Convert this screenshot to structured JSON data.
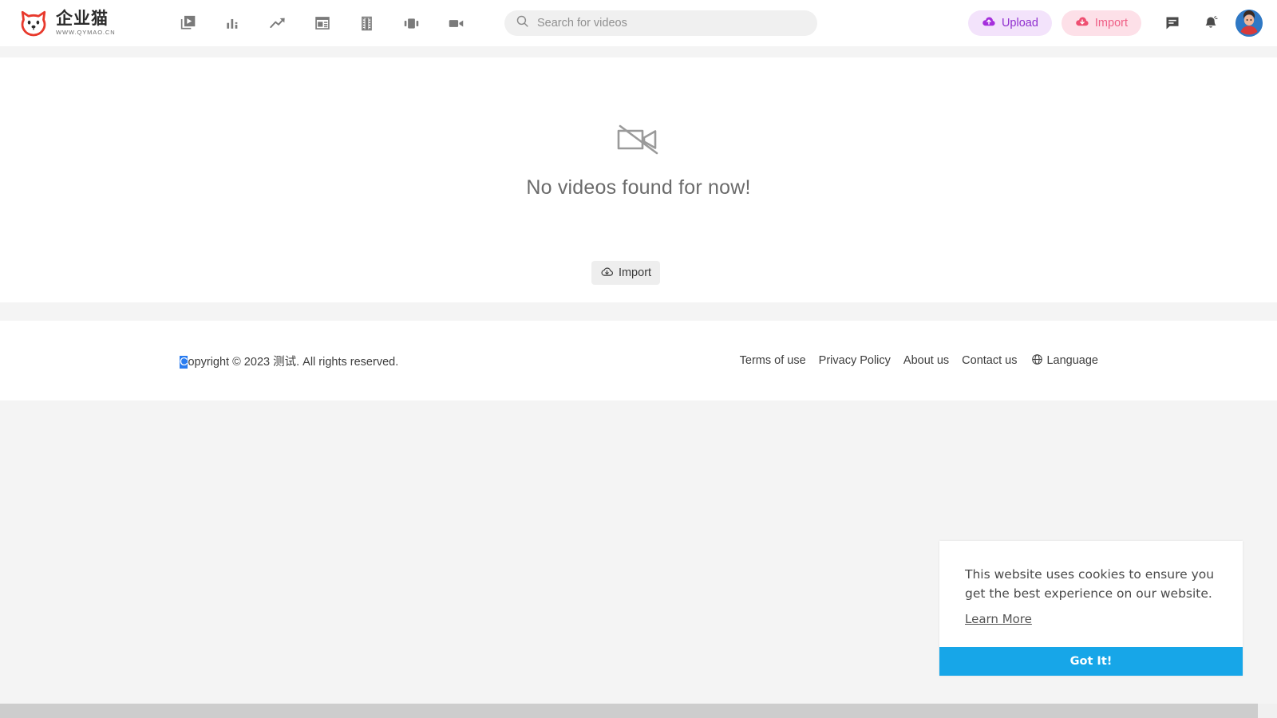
{
  "header": {
    "logo": {
      "name_cn": "企业猫",
      "url_text": "WWW.QYMAO.CN",
      "icon": "cat-face-logo",
      "color": "#e8392c"
    },
    "nav_icons": [
      {
        "name": "video-library-icon",
        "label": "Video Library"
      },
      {
        "name": "bar-chart-icon",
        "label": "Statistics"
      },
      {
        "name": "trending-up-icon",
        "label": "Trends"
      },
      {
        "name": "dashboard-layout-icon",
        "label": "Dashboard"
      },
      {
        "name": "film-strip-icon",
        "label": "Film"
      },
      {
        "name": "carousel-icon",
        "label": "Carousel"
      },
      {
        "name": "video-camera-icon",
        "label": "Camera"
      }
    ],
    "search": {
      "placeholder": "Search for videos",
      "value": "",
      "icon": "search-icon"
    },
    "upload_button": {
      "label": "Upload",
      "icon": "cloud-upload-icon",
      "bg": "#f3e3fb",
      "fg": "#9030cf"
    },
    "import_button": {
      "label": "Import",
      "icon": "cloud-download-icon",
      "bg": "#fde0e8",
      "fg": "#ef5f86"
    },
    "message_icon": "message-icon",
    "notification_icon": "bell-icon",
    "avatar": "user-avatar"
  },
  "main": {
    "empty_icon": "video-camera-off-icon",
    "empty_text": "No videos found for now!",
    "import_button": {
      "label": "Import",
      "icon": "cloud-download-icon"
    }
  },
  "footer": {
    "copyright_selected": "C",
    "copyright_rest": "opyright © 2023 测试. All rights reserved.",
    "links": [
      {
        "label": "Terms of use"
      },
      {
        "label": "Privacy Policy"
      },
      {
        "label": "About us"
      },
      {
        "label": "Contact us"
      }
    ],
    "language": {
      "label": "Language",
      "icon": "globe-icon"
    }
  },
  "cookie_banner": {
    "message": "This website uses cookies to ensure you get the best experience on our website.",
    "learn_more": "Learn More",
    "accept_button": "Got It!",
    "accept_color": "#17a6e8"
  },
  "scrollbar": {
    "orientation": "horizontal"
  }
}
